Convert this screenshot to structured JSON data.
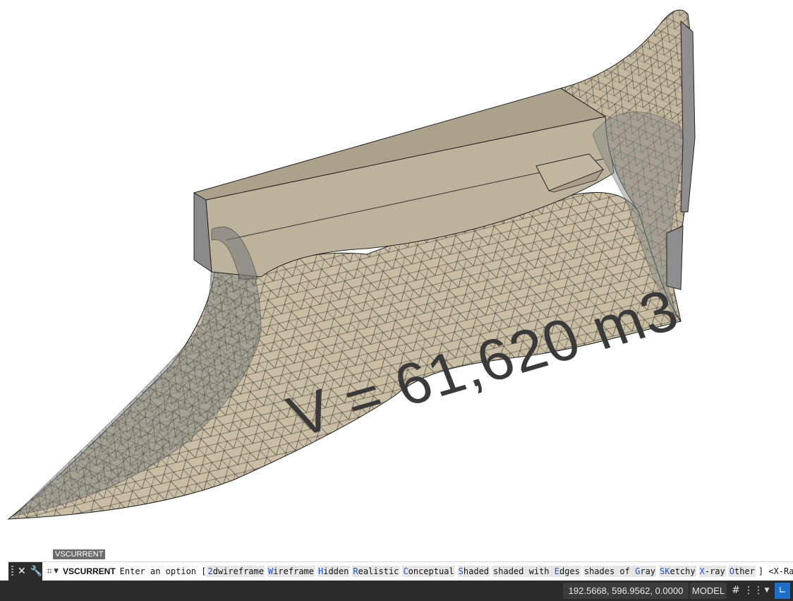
{
  "viewport": {
    "volume_label": "V = 61,620 m3",
    "colors": {
      "mesh_fill": "#c8bca2",
      "mesh_edge": "#1c1c1c",
      "top_face": "#aca28c",
      "side_face": "#8e8e8e",
      "ghost": "#9a9a9a"
    }
  },
  "command_line": {
    "tooltip": "VSCURRENT",
    "command": "VSCURRENT",
    "prompt_pre": "Enter an option [",
    "options": [
      {
        "key": "2",
        "rest": "dwireframe"
      },
      {
        "key": "W",
        "rest": "ireframe"
      },
      {
        "key": "H",
        "rest": "idden"
      },
      {
        "key": "R",
        "rest": "ealistic"
      },
      {
        "key": "C",
        "rest": "onceptual"
      },
      {
        "key": "S",
        "rest": "haded"
      },
      {
        "key": "",
        "rest": "shaded with ",
        "key2": "E",
        "rest2": "dges"
      },
      {
        "key": "",
        "rest": "shades of ",
        "key2": "G",
        "rest2": "ray"
      },
      {
        "key": "SK",
        "rest": "etchy"
      },
      {
        "key": "X",
        "rest": "-ray"
      },
      {
        "key": "O",
        "rest": "ther"
      }
    ],
    "prompt_post": "] <X-Ray>:",
    "icons": [
      "grip-icon",
      "close-icon",
      "wrench-icon",
      "recent-commands-icon",
      "dropdown-arrow-icon"
    ]
  },
  "status_bar": {
    "coordinates": "192.5668, 596.9562, 0.0000",
    "model_label": "MODEL",
    "icons": [
      "grid-icon",
      "snap-icon",
      "dropdown-icon",
      "ortho-icon"
    ]
  }
}
